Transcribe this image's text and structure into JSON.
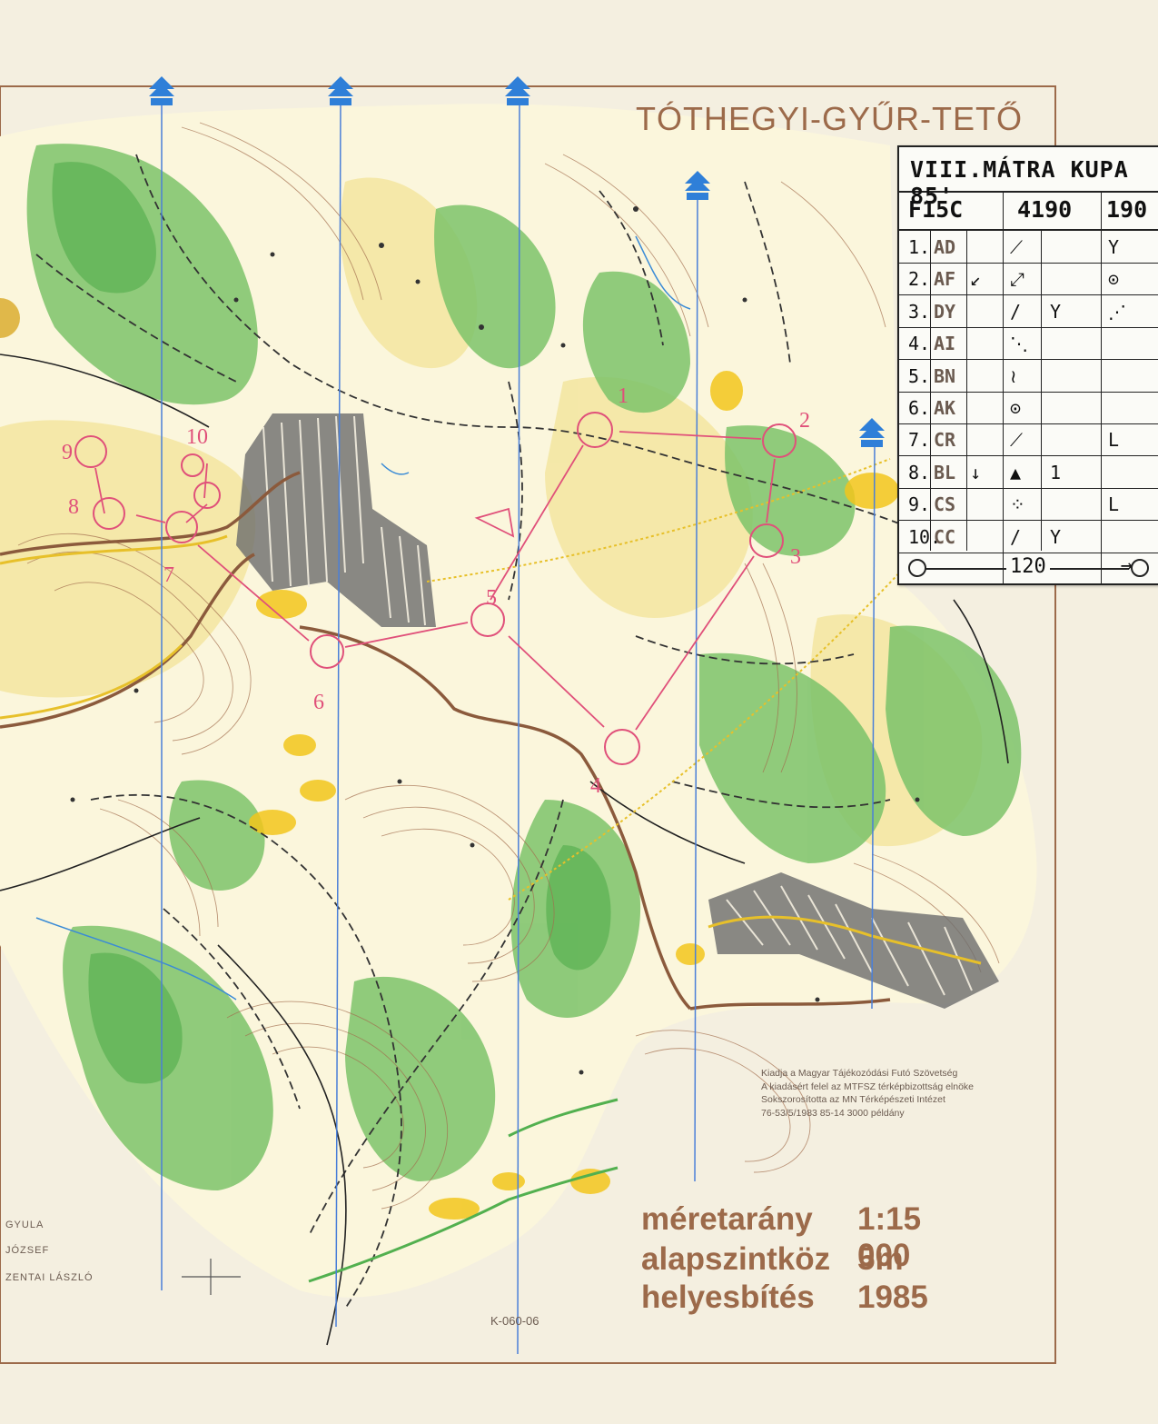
{
  "map": {
    "title": "TÓTHEGYI-GYŰR-TETŐ",
    "colors": {
      "forest": "#7cc36a",
      "forest_dark": "#5fb356",
      "open": "#f2e69a",
      "yellow": "#f2c61c",
      "contour": "#a26d4d",
      "course": "#e0507a",
      "north_line": "#4a7fd8",
      "built": "#6d6d6d"
    },
    "north_arrow_icon": "north-arrow-icon",
    "control_numbers": [
      "1",
      "2",
      "3",
      "4",
      "5",
      "6",
      "7",
      "8",
      "9",
      "10"
    ]
  },
  "control_card": {
    "event": "VIII.MÁTRA KUPA 85'",
    "class": "F15C",
    "length": "4190",
    "climb": "190",
    "controls": [
      {
        "n": "1.",
        "code": "AD",
        "arrow": "",
        "s1": "⟋",
        "s2": "",
        "s3": "Y"
      },
      {
        "n": "2.",
        "code": "AF",
        "arrow": "↙",
        "s1": "⤢",
        "s2": "",
        "s3": "⊙"
      },
      {
        "n": "3.",
        "code": "DY",
        "arrow": "",
        "s1": "/",
        "s2": "Y",
        "s3": "⋰"
      },
      {
        "n": "4.",
        "code": "AI",
        "arrow": "",
        "s1": "⋱",
        "s2": "",
        "s3": ""
      },
      {
        "n": "5.",
        "code": "BN",
        "arrow": "",
        "s1": "≀",
        "s2": "",
        "s3": ""
      },
      {
        "n": "6.",
        "code": "AK",
        "arrow": "",
        "s1": "⊙",
        "s2": "",
        "s3": ""
      },
      {
        "n": "7.",
        "code": "CR",
        "arrow": "",
        "s1": "⟋",
        "s2": "",
        "s3": "L"
      },
      {
        "n": "8.",
        "code": "BL",
        "arrow": "↓",
        "s1": "▲",
        "s2": "1",
        "s3": ""
      },
      {
        "n": "9.",
        "code": "CS",
        "arrow": "",
        "s1": "⁘",
        "s2": "",
        "s3": "L"
      },
      {
        "n": "10.",
        "code": "CC",
        "arrow": "",
        "s1": "/",
        "s2": "Y",
        "s3": ""
      }
    ],
    "finish_distance": "120"
  },
  "publisher": [
    "Kiadja a Magyar Tájékozódási Futó Szövetség",
    "A kiadásért felel az MTFSZ térképbizottság elnöke",
    "Sokszorosította az MN Térképészeti Intézet",
    "76-53/5/1983  85-14  3000 példány"
  ],
  "scale_info": [
    {
      "label": "méretarány",
      "value": "1:15 000"
    },
    {
      "label": "alapszintköz",
      "value": "5m"
    },
    {
      "label": "helyesbítés",
      "value": "1985"
    }
  ],
  "credits": [
    "GYULA",
    "JÓZSEF",
    "ZENTAI LÁSZLÓ"
  ],
  "map_code": "K-060-06"
}
